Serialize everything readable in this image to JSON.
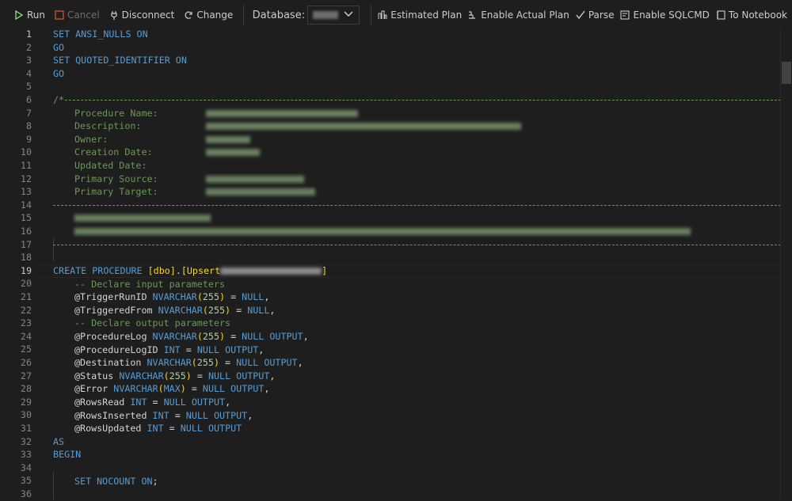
{
  "toolbar": {
    "run": "Run",
    "cancel": "Cancel",
    "disconnect": "Disconnect",
    "change": "Change",
    "database_label": "Database:",
    "estimated_plan": "Estimated Plan",
    "enable_actual_plan": "Enable Actual Plan",
    "parse": "Parse",
    "enable_sqlcmd": "Enable SQLCMD",
    "to_notebook": "To Notebook"
  },
  "editor": {
    "l1": {
      "a": "SET ANSI_NULLS ON"
    },
    "l2": {
      "a": "GO"
    },
    "l3": {
      "a": "SET QUOTED_IDENTIFIER ON"
    },
    "l4": {
      "a": "GO"
    },
    "l6": {
      "a": "/*"
    },
    "l7": {
      "a": "Procedure Name:"
    },
    "l8": {
      "a": "Description:"
    },
    "l9": {
      "a": "Owner:"
    },
    "l10": {
      "a": "Creation Date:"
    },
    "l11": {
      "a": "Updated Date:"
    },
    "l12": {
      "a": "Primary Source:"
    },
    "l13": {
      "a": "Primary Target:"
    },
    "l19": {
      "a": "CREATE PROCEDURE ",
      "b": "[dbo]",
      "c": ".",
      "d": "[Upsert",
      "e": "]"
    },
    "l20": {
      "a": "-- Declare input parameters"
    },
    "l21": {
      "a": "@TriggerRunID",
      "b": "NVARCHAR",
      "c": "255",
      "d": "NULL"
    },
    "l22": {
      "a": "@TriggeredFrom",
      "b": "NVARCHAR",
      "c": "255",
      "d": "NULL"
    },
    "l23": {
      "a": "-- Declare output parameters"
    },
    "l24": {
      "a": "@ProcedureLog",
      "b": "NVARCHAR",
      "c": "255",
      "d": "NULL",
      "e": "OUTPUT"
    },
    "l25": {
      "a": "@ProcedureLogID",
      "b": "INT",
      "d": "NULL",
      "e": "OUTPUT"
    },
    "l26": {
      "a": "@Destination",
      "b": "NVARCHAR",
      "c": "255",
      "d": "NULL",
      "e": "OUTPUT"
    },
    "l27": {
      "a": "@Status",
      "b": "NVARCHAR",
      "c": "255",
      "d": "NULL",
      "e": "OUTPUT"
    },
    "l28": {
      "a": "@Error",
      "b": "NVARCHAR",
      "c": "MAX",
      "d": "NULL",
      "e": "OUTPUT"
    },
    "l29": {
      "a": "@RowsRead",
      "b": "INT",
      "d": "NULL",
      "e": "OUTPUT"
    },
    "l30": {
      "a": "@RowsInserted",
      "b": "INT",
      "d": "NULL",
      "e": "OUTPUT"
    },
    "l31": {
      "a": "@RowsUpdated",
      "b": "INT",
      "d": "NULL",
      "e": "OUTPUT"
    },
    "l32": {
      "a": "AS"
    },
    "l33": {
      "a": "BEGIN"
    },
    "l35": {
      "a": "SET NOCOUNT ON",
      "b": ";"
    }
  },
  "line_numbers": [
    "1",
    "2",
    "3",
    "4",
    "5",
    "6",
    "7",
    "8",
    "9",
    "10",
    "11",
    "12",
    "13",
    "14",
    "15",
    "16",
    "17",
    "18",
    "19",
    "20",
    "21",
    "22",
    "23",
    "24",
    "25",
    "26",
    "27",
    "28",
    "29",
    "30",
    "31",
    "32",
    "33",
    "34",
    "35",
    "36"
  ],
  "colors": {
    "keyword": "#569cd6",
    "comment": "#6a9955",
    "bracket": "#ffd700",
    "background": "#1e1e1e"
  }
}
